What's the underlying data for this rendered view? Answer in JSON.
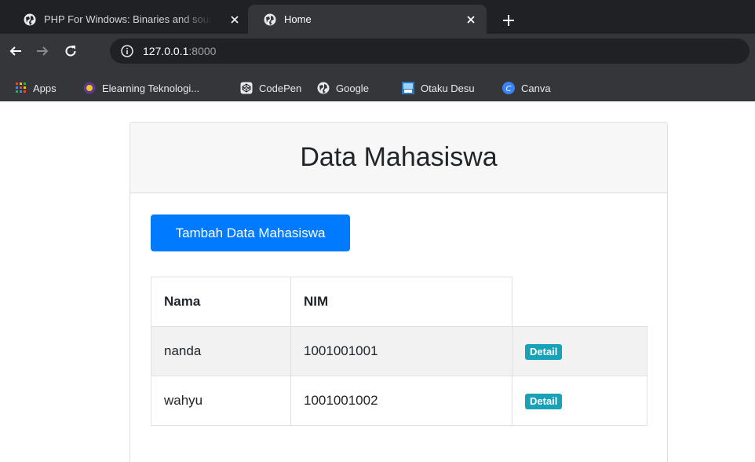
{
  "browser": {
    "tabs": [
      {
        "title": "PHP For Windows: Binaries and sources Releases",
        "active": false
      },
      {
        "title": "Home",
        "active": true
      }
    ],
    "url_host": "127.0.0.1",
    "url_port": ":8000",
    "bookmarks": [
      {
        "label": "Apps",
        "icon": "apps-grid-icon"
      },
      {
        "label": "Elearning Teknologi...",
        "icon": "elearning-logo-icon"
      },
      {
        "label": "CodePen",
        "icon": "codepen-icon"
      },
      {
        "label": "Google",
        "icon": "globe-icon"
      },
      {
        "label": "Otaku Desu",
        "icon": "otakudesu-icon"
      },
      {
        "label": "Canva",
        "icon": "canva-icon"
      }
    ]
  },
  "page": {
    "title": "Data Mahasiswa",
    "add_button_label": "Tambah Data Mahasiswa",
    "table": {
      "headers": {
        "nama": "Nama",
        "nim": "NIM"
      },
      "rows": [
        {
          "nama": "nanda",
          "nim": "1001001001",
          "action": "Detail"
        },
        {
          "nama": "wahyu",
          "nim": "1001001002",
          "action": "Detail"
        }
      ]
    }
  },
  "colors": {
    "primary": "#007bff",
    "info": "#17a2b8",
    "chrome_dark": "#202124",
    "chrome_toolbar": "#35363a"
  }
}
